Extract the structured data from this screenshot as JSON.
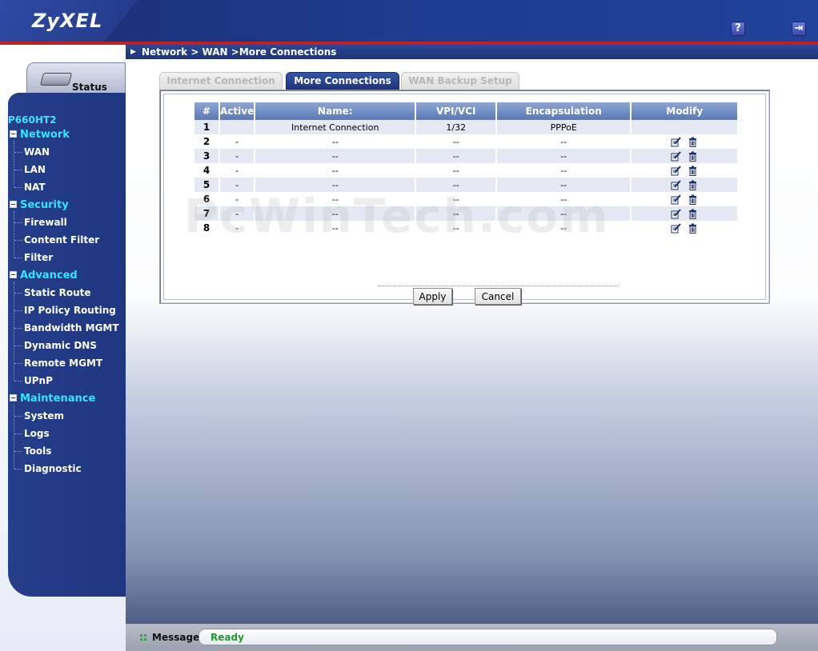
{
  "brand": "ZyXEL",
  "header": {
    "help_label": "?",
    "logout_label": "⇥"
  },
  "breadcrumb": "Network > WAN >More Connections",
  "sidebar": {
    "status_label": "Status",
    "model": "P660HT2",
    "sections": [
      {
        "label": "Network",
        "items": [
          "WAN",
          "LAN",
          "NAT"
        ]
      },
      {
        "label": "Security",
        "items": [
          "Firewall",
          "Content Filter",
          "Filter"
        ]
      },
      {
        "label": "Advanced",
        "items": [
          "Static Route",
          "IP Policy Routing",
          "Bandwidth MGMT",
          "Dynamic DNS",
          "Remote MGMT",
          "UPnP"
        ]
      },
      {
        "label": "Maintenance",
        "items": [
          "System",
          "Logs",
          "Tools",
          "Diagnostic"
        ]
      }
    ]
  },
  "tabs": [
    {
      "label": "Internet Connection",
      "active": false
    },
    {
      "label": "More Connections",
      "active": true
    },
    {
      "label": "WAN Backup Setup",
      "active": false
    }
  ],
  "table": {
    "headers": [
      "#",
      "Active",
      "Name:",
      "VPI/VCI",
      "Encapsulation",
      "Modify"
    ],
    "rows": [
      {
        "num": "1",
        "active": "",
        "name": "Internet Connection",
        "vpi_vci": "1/32",
        "encapsulation": "PPPoE",
        "modify": false
      },
      {
        "num": "2",
        "active": "-",
        "name": "--",
        "vpi_vci": "--",
        "encapsulation": "--",
        "modify": true
      },
      {
        "num": "3",
        "active": "-",
        "name": "--",
        "vpi_vci": "--",
        "encapsulation": "--",
        "modify": true
      },
      {
        "num": "4",
        "active": "-",
        "name": "--",
        "vpi_vci": "--",
        "encapsulation": "--",
        "modify": true
      },
      {
        "num": "5",
        "active": "-",
        "name": "--",
        "vpi_vci": "--",
        "encapsulation": "--",
        "modify": true
      },
      {
        "num": "6",
        "active": "-",
        "name": "--",
        "vpi_vci": "--",
        "encapsulation": "--",
        "modify": true
      },
      {
        "num": "7",
        "active": "-",
        "name": "--",
        "vpi_vci": "--",
        "encapsulation": "--",
        "modify": true
      },
      {
        "num": "8",
        "active": "-",
        "name": "--",
        "vpi_vci": "--",
        "encapsulation": "--",
        "modify": true
      }
    ]
  },
  "buttons": {
    "apply": "Apply",
    "cancel": "Cancel"
  },
  "watermark": "PcWinTech.com",
  "footer": {
    "message_label": "Message",
    "message": "Ready"
  },
  "icons": {
    "edit": "edit-icon",
    "delete": "trash-icon",
    "help": "help-icon",
    "logout": "logout-icon",
    "router": "router-icon"
  },
  "colors": {
    "nav_bg": "#1f3680",
    "section_text": "#2fe6ff",
    "active_tab": "#20347c",
    "status_ready": "#1e9a2a",
    "accent_red": "#c02020"
  }
}
